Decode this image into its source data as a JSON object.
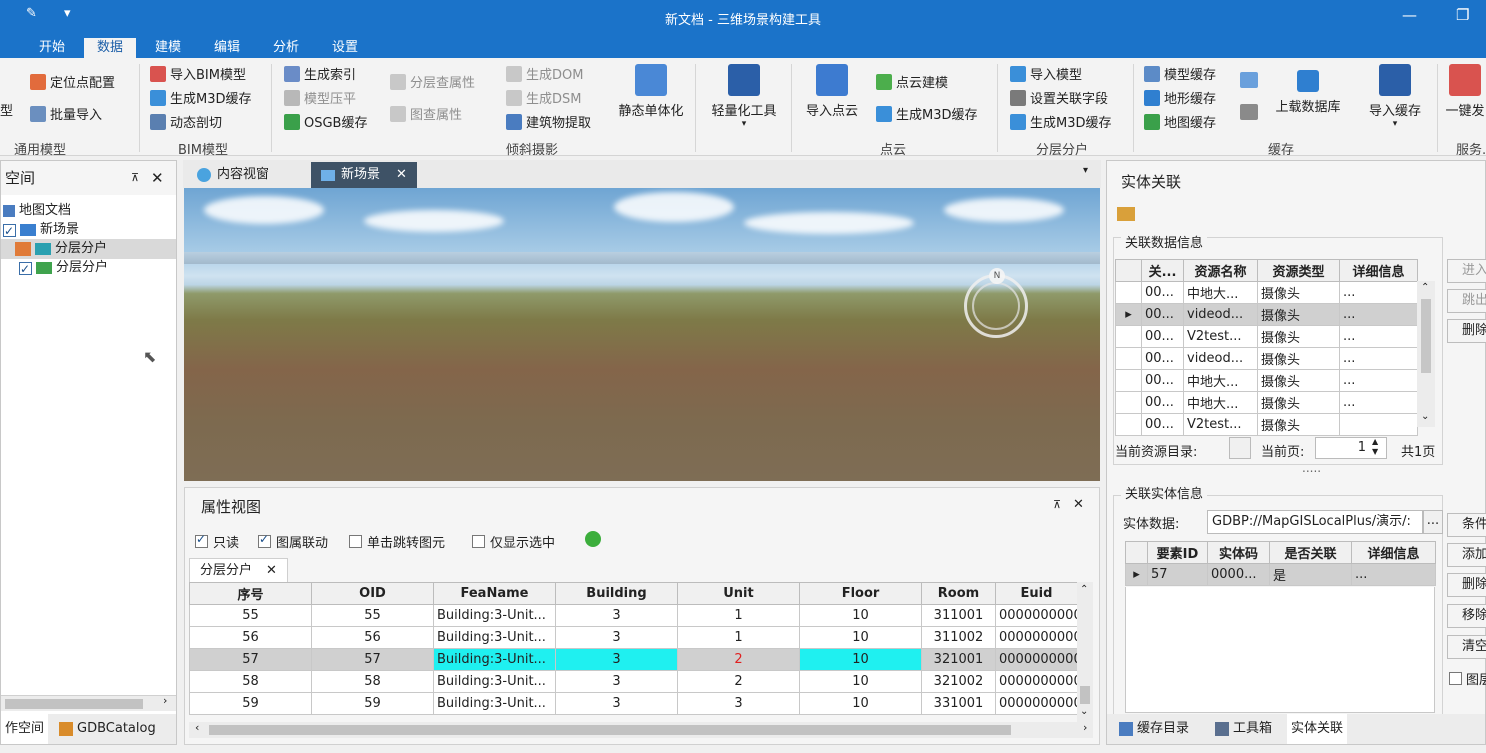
{
  "window": {
    "title": "新文档 - 三维场景构建工具"
  },
  "ribbon_tabs": [
    "开始",
    "数据",
    "建模",
    "编辑",
    "分析",
    "设置"
  ],
  "ribbon": {
    "general": {
      "label": "通用模型",
      "items": [
        "定位点配置",
        "批量导入"
      ],
      "cut_label": "型"
    },
    "bim": {
      "label": "BIM模型",
      "items": [
        "导入BIM模型",
        "生成M3D缓存",
        "动态剖切"
      ]
    },
    "oblique": {
      "label": "倾斜摄影",
      "items_a": [
        "生成索引",
        "模型压平",
        "OSGB缓存"
      ],
      "items_b": [
        "分层查属性",
        "图查属性"
      ],
      "items_c": [
        "生成DOM",
        "生成DSM",
        "建筑物提取"
      ],
      "big": "静态单体化"
    },
    "lightweight": {
      "big": "轻量化工具"
    },
    "pointcloud": {
      "label": "点云",
      "big": "导入点云",
      "items": [
        "点云建模",
        "生成M3D缓存"
      ]
    },
    "layered": {
      "label": "分层分户",
      "items": [
        "导入模型",
        "设置关联字段",
        "生成M3D缓存"
      ]
    },
    "cache": {
      "label": "缓存",
      "items": [
        "模型缓存",
        "地形缓存",
        "地图缓存"
      ],
      "big_a": "上载数据库",
      "big_b": "导入缓存"
    },
    "service": {
      "label": "服务...",
      "big": "一键发"
    }
  },
  "left_panel": {
    "title": "空间",
    "tree": [
      {
        "label": "地图文档",
        "level": 0
      },
      {
        "label": "新场景",
        "level": 1
      },
      {
        "label": "分层分户",
        "level": 2,
        "checked": true
      },
      {
        "label": "分层分户",
        "level": 2,
        "checked": true
      }
    ],
    "bottom_tabs": [
      "作空间",
      "GDBCatalog"
    ]
  },
  "doc_tabs": [
    "内容视窗",
    "新场景"
  ],
  "compass": {
    "label": "N"
  },
  "attr_view": {
    "title": "属性视图",
    "toolbar": [
      {
        "label": "只读",
        "checked": true
      },
      {
        "label": "图属联动",
        "checked": true
      },
      {
        "label": "单击跳转图元",
        "checked": false
      },
      {
        "label": "仅显示选中",
        "checked": false
      }
    ],
    "tab": "分层分户",
    "columns": [
      "序号",
      "OID",
      "FeaName",
      "Building",
      "Unit",
      "Floor",
      "Room",
      "Euid"
    ],
    "rows": [
      [
        "55",
        "55",
        "Building:3-Unit...",
        "3",
        "1",
        "10",
        "311001",
        "0000000000"
      ],
      [
        "56",
        "56",
        "Building:3-Unit...",
        "3",
        "1",
        "10",
        "311002",
        "0000000000"
      ],
      [
        "57",
        "57",
        "Building:3-Unit...",
        "3",
        "2",
        "10",
        "321001",
        "0000000000"
      ],
      [
        "58",
        "58",
        "Building:3-Unit...",
        "3",
        "2",
        "10",
        "321002",
        "0000000000"
      ],
      [
        "59",
        "59",
        "Building:3-Unit...",
        "3",
        "3",
        "10",
        "331001",
        "0000000000"
      ]
    ],
    "highlight_color": "#1ff0f0"
  },
  "right_panel": {
    "title": "实体关联",
    "assoc_data": {
      "label": "关联数据信息",
      "columns": [
        "关...",
        "资源名称",
        "资源类型",
        "详细信息"
      ],
      "rows": [
        [
          "00...",
          "中地大...",
          "摄像头",
          "..."
        ],
        [
          "00...",
          "videod...",
          "摄像头",
          "..."
        ],
        [
          "00...",
          "V2test...",
          "摄像头",
          "..."
        ],
        [
          "00...",
          "videod...",
          "摄像头",
          "..."
        ],
        [
          "00...",
          "中地大...",
          "摄像头",
          "..."
        ],
        [
          "00...",
          "中地大...",
          "摄像头",
          "..."
        ],
        [
          "00...",
          "V2test...",
          "摄像头",
          ""
        ]
      ],
      "buttons": [
        "进入",
        "跳出",
        "删除"
      ],
      "current_dir_label": "当前资源目录:",
      "current_page_label": "当前页:",
      "current_page": "1",
      "total_pages": "共1页",
      "splitter": "....."
    },
    "assoc_entity": {
      "label": "关联实体信息",
      "entity_data_label": "实体数据:",
      "entity_data_value": "GDBP://MapGISLocalPlus/演示/:",
      "browse": "...",
      "columns": [
        "要素ID",
        "实体码",
        "是否关联",
        "详细信息"
      ],
      "rows": [
        [
          "57",
          "0000...",
          "是",
          "..."
        ]
      ],
      "buttons": [
        "条件",
        "添加",
        "删除",
        "移除",
        "清空"
      ],
      "checkbox_label": "图层"
    },
    "bottom_tabs": [
      "缓存目录",
      "工具箱",
      "实体关联"
    ]
  }
}
